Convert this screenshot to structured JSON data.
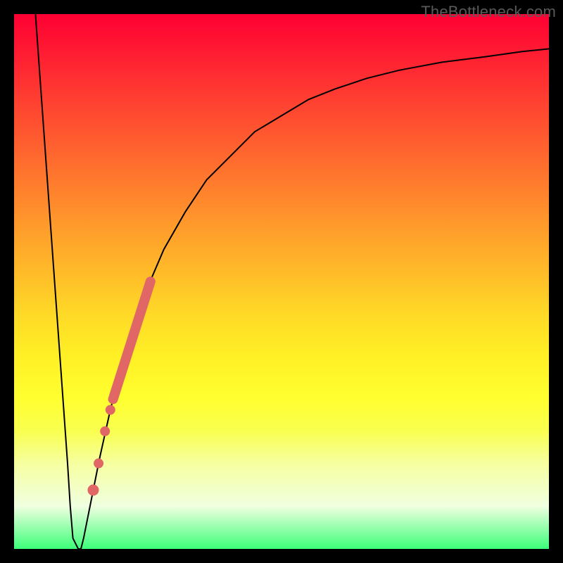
{
  "watermark": "TheBottleneck.com",
  "chart_data": {
    "type": "line",
    "title": "",
    "xlabel": "",
    "ylabel": "",
    "xlim": [
      0,
      100
    ],
    "ylim": [
      0,
      100
    ],
    "grid": false,
    "legend": false,
    "background": "rainbow_vertical_red_to_green",
    "series": [
      {
        "name": "bottleneck-curve-left",
        "color": "#000000",
        "stroke_width": 2,
        "x": [
          4,
          5,
          6,
          7,
          8,
          9,
          10,
          10.5,
          11,
          12,
          12.5
        ],
        "y": [
          100,
          86,
          72,
          58,
          44,
          30,
          16,
          8,
          2,
          0,
          0
        ]
      },
      {
        "name": "bottleneck-curve-right",
        "color": "#000000",
        "stroke_width": 2,
        "x": [
          12.5,
          13,
          14,
          15,
          16,
          18,
          20,
          22,
          25,
          28,
          32,
          36,
          40,
          45,
          50,
          55,
          60,
          66,
          72,
          80,
          88,
          95,
          100
        ],
        "y": [
          0,
          2,
          7,
          12,
          17,
          26,
          34,
          41,
          49,
          56,
          63,
          69,
          73,
          78,
          81,
          84,
          86,
          88,
          89.5,
          91,
          92,
          93,
          93.5
        ]
      }
    ],
    "markers": [
      {
        "name": "highlight-segment",
        "type": "segment",
        "color": "#e06765",
        "stroke_width": 14,
        "x1": 18.5,
        "y1": 28,
        "x2": 25.5,
        "y2": 50
      },
      {
        "name": "dot-1",
        "type": "circle",
        "color": "#e06765",
        "r": 7,
        "x": 18.0,
        "y": 26
      },
      {
        "name": "dot-2",
        "type": "circle",
        "color": "#e06765",
        "r": 7,
        "x": 17.0,
        "y": 22
      },
      {
        "name": "dot-3",
        "type": "circle",
        "color": "#e06765",
        "r": 7,
        "x": 15.8,
        "y": 16
      },
      {
        "name": "dot-4",
        "type": "circle",
        "color": "#e06765",
        "r": 8,
        "x": 14.8,
        "y": 11
      }
    ]
  }
}
